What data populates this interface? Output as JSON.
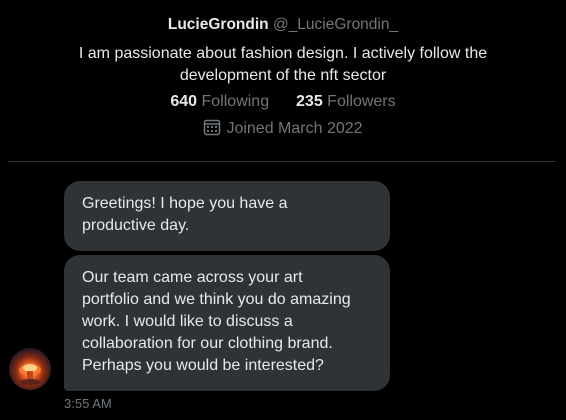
{
  "profile": {
    "display_name": "LucieGrondin",
    "handle": "@_LucieGrondin_",
    "bio": "I am passionate about fashion design. I actively follow the development of the nft sector",
    "following_count": "640",
    "following_label": "Following",
    "followers_count": "235",
    "followers_label": "Followers",
    "joined_icon": "calendar-icon",
    "joined": "Joined March 2022"
  },
  "conversation": {
    "messages": [
      {
        "text": "Greetings!  I hope you have a\nproductive day."
      },
      {
        "text": "Our team came across your art\nportfolio and we think you do amazing\nwork. I would like to discuss a\ncollaboration for our clothing brand.\nPerhaps you would be interested?"
      }
    ],
    "sender_avatar": "avatar-image",
    "timestamp": "3:55 AM"
  },
  "colors": {
    "background": "#000000",
    "bubble": "#2f3336",
    "primary_text": "#e7e9ea",
    "secondary_text": "#71767b",
    "divider": "#2f3336"
  }
}
